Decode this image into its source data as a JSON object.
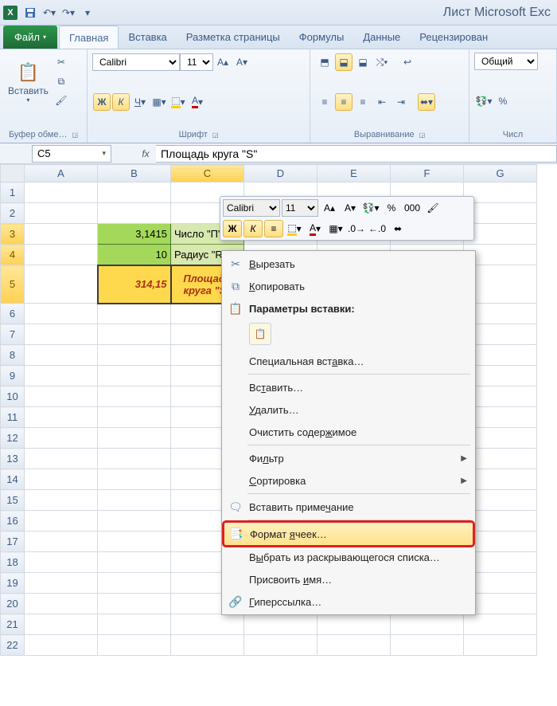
{
  "title": "Лист Microsoft Exc",
  "tabs": {
    "file": "Файл",
    "home": "Главная",
    "insert": "Вставка",
    "layout": "Разметка страницы",
    "formulas": "Формулы",
    "data": "Данные",
    "review": "Рецензирован"
  },
  "ribbon": {
    "clipboard": {
      "paste": "Вставить",
      "label": "Буфер обме…"
    },
    "font": {
      "name": "Calibri",
      "size": "11",
      "label": "Шрифт"
    },
    "alignment": {
      "label": "Выравнивание"
    },
    "number": {
      "format": "Общий",
      "label": "Числ"
    }
  },
  "formula_bar": {
    "cell": "C5",
    "value": "Площадь круга \"S\""
  },
  "columns": [
    "A",
    "B",
    "C",
    "D",
    "E",
    "F",
    "G"
  ],
  "cells": {
    "b3": "3,1415",
    "c3": "Число \"П\"",
    "b4": "10",
    "c4": "Радиус \"R\"",
    "b5": "314,15",
    "c5": "Площадь круга \"S\""
  },
  "mini": {
    "font": "Calibri",
    "size": "11"
  },
  "ctx": {
    "cut": "Вырезать",
    "copy": "Копировать",
    "paste_params": "Параметры вставки:",
    "paste_special": "Специальная вставка…",
    "insert": "Вставить…",
    "delete": "Удалить…",
    "clear": "Очистить содержимое",
    "filter": "Фильтр",
    "sort": "Сортировка",
    "comment": "Вставить примечание",
    "format_cells": "Формат ячеек…",
    "dropdown_pick": "Выбрать из раскрывающегося списка…",
    "define_name": "Присвоить имя…",
    "hyperlink": "Гиперссылка…"
  }
}
